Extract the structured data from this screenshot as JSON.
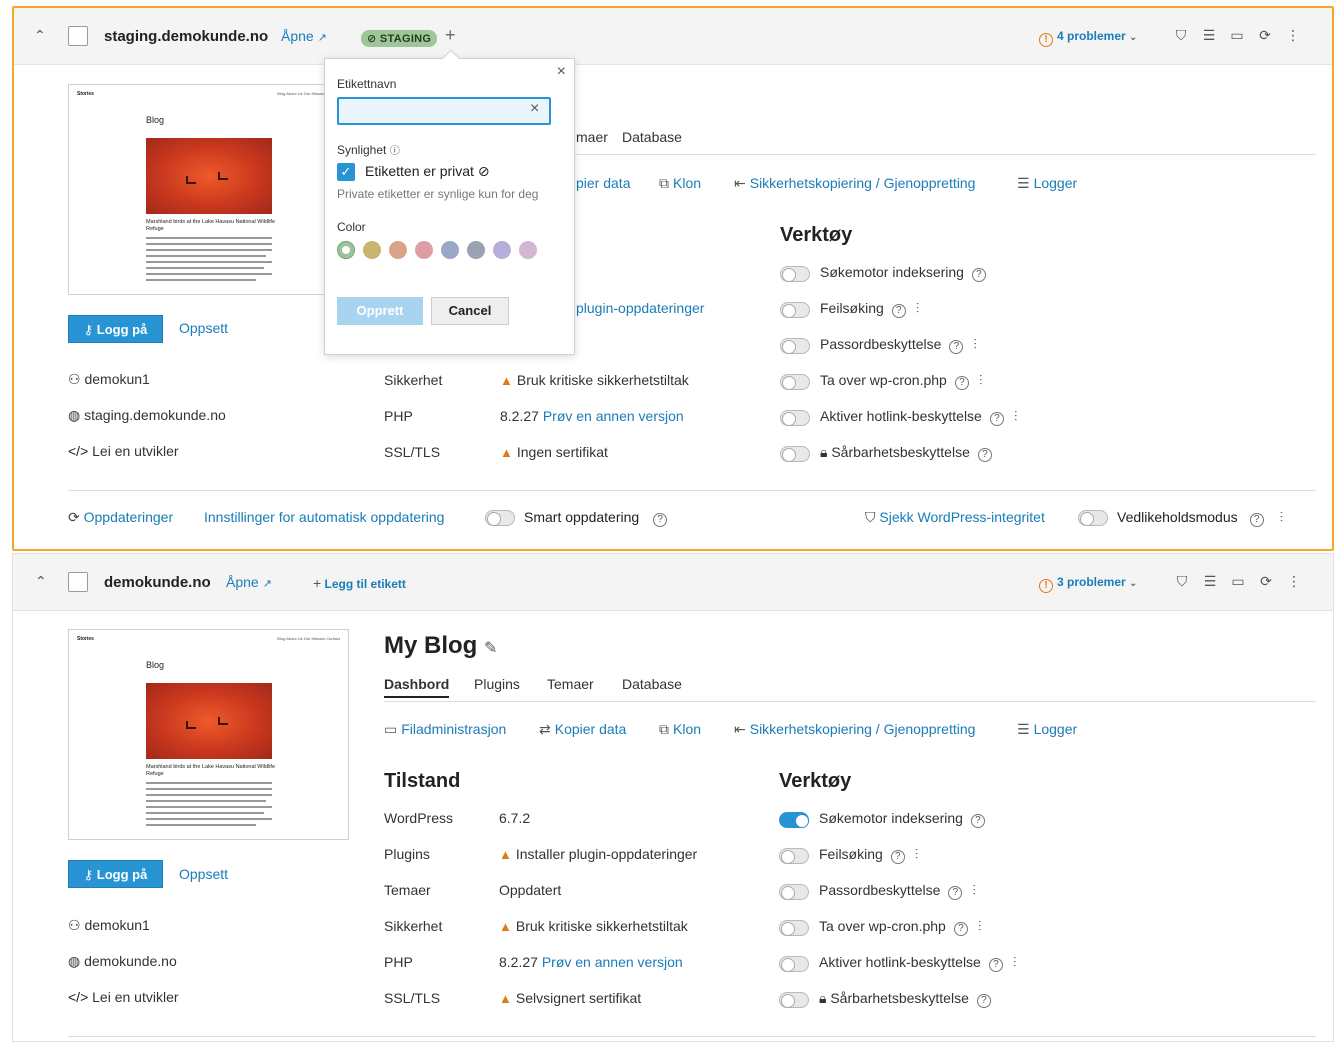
{
  "site1": {
    "domain": "staging.demokunde.no",
    "open": "Åpne",
    "tag": "STAGING",
    "problems": "4 problemer",
    "login": "Logg på",
    "setup": "Oppsett",
    "user": "demokun1",
    "host": "staging.demokunde.no",
    "dev": "Lei en utvikler",
    "tabs_partial": [
      "maer",
      "Database"
    ],
    "actions": [
      "pier data",
      "Klon",
      "Sikkerhetskopiering / Gjenoppretting",
      "Logger"
    ],
    "plugins_partial": "plugin-oppdateringer",
    "tools_title": "Verktøy",
    "rows": [
      {
        "label": "Sikkerhet",
        "value": "Bruk kritiske sikkerhetstiltak"
      },
      {
        "label": "PHP",
        "version": "8.2.27",
        "value": "Prøv en annen versjon"
      },
      {
        "label": "SSL/TLS",
        "value": "Ingen sertifikat"
      }
    ],
    "tools": [
      "Søkemotor indeksering",
      "Feilsøking",
      "Passordbeskyttelse",
      "Ta over wp-cron.php",
      "Aktiver hotlink-beskyttelse",
      "Sårbarhetsbeskyttelse"
    ],
    "bottom": {
      "updates": "Oppdateringer",
      "auto": "Innstillinger for automatisk oppdatering",
      "smart": "Smart oppdatering",
      "integrity": "Sjekk WordPress-integritet",
      "maintenance": "Vedlikeholdsmodus"
    }
  },
  "popover": {
    "name_label": "Etikettnavn",
    "name_value": "",
    "visibility_label": "Synlighet",
    "private_label": "Etiketten er privat",
    "private_hint": "Private etiketter er synlige kun for deg",
    "color_label": "Color",
    "colors": [
      "#9cc49a",
      "#c9b56d",
      "#dba48a",
      "#dc9ea3",
      "#9aa7c6",
      "#9ba2b2",
      "#b7aedb",
      "#d3b6d2"
    ],
    "create": "Opprett",
    "cancel": "Cancel"
  },
  "site2": {
    "domain": "demokunde.no",
    "open": "Åpne",
    "add_label": "Legg til etikett",
    "problems": "3 problemer",
    "title": "My Blog",
    "tabs": [
      "Dashbord",
      "Plugins",
      "Temaer",
      "Database"
    ],
    "actions": [
      "Filadministrasjon",
      "Kopier data",
      "Klon",
      "Sikkerhetskopiering / Gjenoppretting",
      "Logger"
    ],
    "state_title": "Tilstand",
    "tools_title": "Verktøy",
    "login": "Logg på",
    "setup": "Oppsett",
    "user": "demokun1",
    "host": "demokunde.no",
    "dev": "Lei en utvikler",
    "rows": [
      {
        "label": "WordPress",
        "value": "6.7.2"
      },
      {
        "label": "Plugins",
        "value": "Installer plugin-oppdateringer"
      },
      {
        "label": "Temaer",
        "value": "Oppdatert"
      },
      {
        "label": "Sikkerhet",
        "value": "Bruk kritiske sikkerhetstiltak"
      },
      {
        "label": "PHP",
        "version": "8.2.27",
        "value": "Prøv en annen versjon"
      },
      {
        "label": "SSL/TLS",
        "value": "Selvsignert sertifikat"
      }
    ],
    "tools": [
      "Søkemotor indeksering",
      "Feilsøking",
      "Passordbeskyttelse",
      "Ta over wp-cron.php",
      "Aktiver hotlink-beskyttelse",
      "Sårbarhetsbeskyttelse"
    ]
  },
  "thumb": {
    "brand": "Stories",
    "nav": "Blog  About Us  Our Mission  Contact",
    "heading": "Blog",
    "caption": "Marshland birds at the Lake Havasu National Wildlife Refuge"
  }
}
